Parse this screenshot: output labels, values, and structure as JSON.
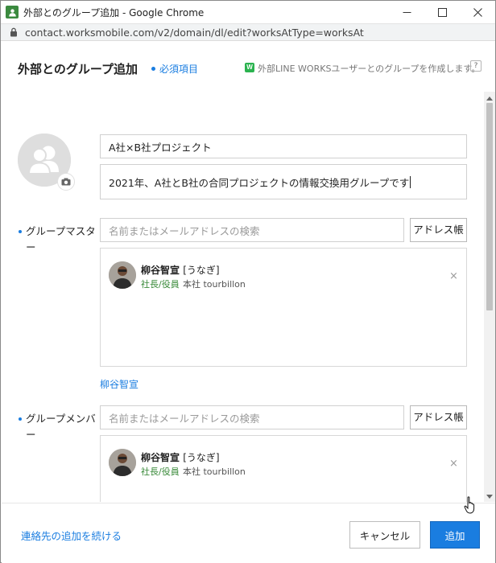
{
  "window": {
    "title": "外部とのグループ追加 - Google Chrome",
    "url": "contact.worksmobile.com/v2/domain/dl/edit?worksAtType=worksAt"
  },
  "dialog": {
    "title": "外部とのグループ追加",
    "required_label": "必須項目",
    "hint": "外部LINE WORKSユーザーとのグループを作成します。",
    "hint_icon_text": "W",
    "help_label": "?"
  },
  "form": {
    "group_name": "A社×B社プロジェクト",
    "description": "2021年、A社とB社の合同プロジェクトの情報交換用グループです",
    "master": {
      "label_line1": "グループマスタ",
      "label_line2": "ー",
      "search_placeholder": "名前またはメールアドレスの検索",
      "address_book_label": "アドレス帳",
      "members": [
        {
          "name": "柳谷智宣",
          "nickname": "[うなぎ]",
          "role": "社長/役員",
          "meta": "本社 tourbillon"
        }
      ],
      "summary_link": "柳谷智宣"
    },
    "members": {
      "label_line1": "グループメンバ",
      "label_line2": "ー",
      "search_placeholder": "名前またはメールアドレスの検索",
      "address_book_label": "アドレス帳",
      "members": [
        {
          "name": "柳谷智宣",
          "nickname": "[うなぎ]",
          "role": "社長/役員",
          "meta": "本社 tourbillon"
        }
      ]
    }
  },
  "footer": {
    "continue_link": "連絡先の追加を続ける",
    "cancel_label": "キャンセル",
    "add_label": "追加"
  },
  "colors": {
    "accent": "#1a7de0",
    "role_green": "#3a8a3a",
    "app_icon": "#3b8a3f"
  },
  "icons": [
    "contact-app-icon",
    "minimize-icon",
    "maximize-icon",
    "close-icon",
    "lock-icon",
    "default-group-avatar-icon",
    "camera-icon",
    "remove-icon",
    "mouse-cursor-icon"
  ]
}
